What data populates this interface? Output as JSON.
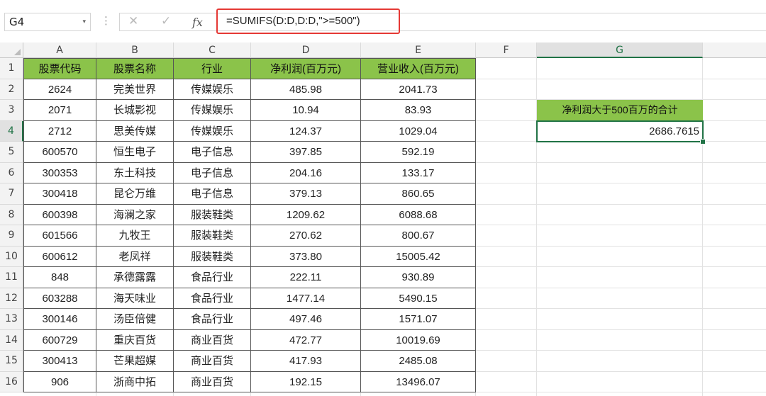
{
  "formula_bar": {
    "cell_ref": "G4",
    "cancel_icon": "✕",
    "enter_icon": "✓",
    "fx_label": "fx",
    "formula": "=SUMIFS(D:D,D:D,\">=500\")"
  },
  "columns": [
    "A",
    "B",
    "C",
    "D",
    "E",
    "F",
    "G"
  ],
  "rows": [
    "1",
    "2",
    "3",
    "4",
    "5",
    "6",
    "7",
    "8",
    "9",
    "10",
    "11",
    "12",
    "13",
    "14",
    "15",
    "16"
  ],
  "table": {
    "headers": [
      "股票代码",
      "股票名称",
      "行业",
      "净利润(百万元)",
      "营业收入(百万元)"
    ],
    "rows": [
      [
        "2624",
        "完美世界",
        "传媒娱乐",
        "485.98",
        "2041.73"
      ],
      [
        "2071",
        "长城影视",
        "传媒娱乐",
        "10.94",
        "83.93"
      ],
      [
        "2712",
        "思美传媒",
        "传媒娱乐",
        "124.37",
        "1029.04"
      ],
      [
        "600570",
        "恒生电子",
        "电子信息",
        "397.85",
        "592.19"
      ],
      [
        "300353",
        "东土科技",
        "电子信息",
        "204.16",
        "133.17"
      ],
      [
        "300418",
        "昆仑万维",
        "电子信息",
        "379.13",
        "860.65"
      ],
      [
        "600398",
        "海澜之家",
        "服装鞋类",
        "1209.62",
        "6088.68"
      ],
      [
        "601566",
        "九牧王",
        "服装鞋类",
        "270.62",
        "800.67"
      ],
      [
        "600612",
        "老凤祥",
        "服装鞋类",
        "373.80",
        "15005.42"
      ],
      [
        "848",
        "承德露露",
        "食品行业",
        "222.11",
        "930.89"
      ],
      [
        "603288",
        "海天味业",
        "食品行业",
        "1477.14",
        "5490.15"
      ],
      [
        "300146",
        "汤臣倍健",
        "食品行业",
        "497.46",
        "1571.07"
      ],
      [
        "600729",
        "重庆百货",
        "商业百货",
        "472.77",
        "10019.69"
      ],
      [
        "300413",
        "芒果超媒",
        "商业百货",
        "417.93",
        "2485.08"
      ],
      [
        "906",
        "浙商中拓",
        "商业百货",
        "192.15",
        "13496.07"
      ]
    ]
  },
  "summary": {
    "label": "净利润大于500百万的合计",
    "value": "2686.7615"
  },
  "colors": {
    "header_fill": "#8bc34a",
    "selection": "#217346",
    "formula_highlight": "#e53935"
  }
}
